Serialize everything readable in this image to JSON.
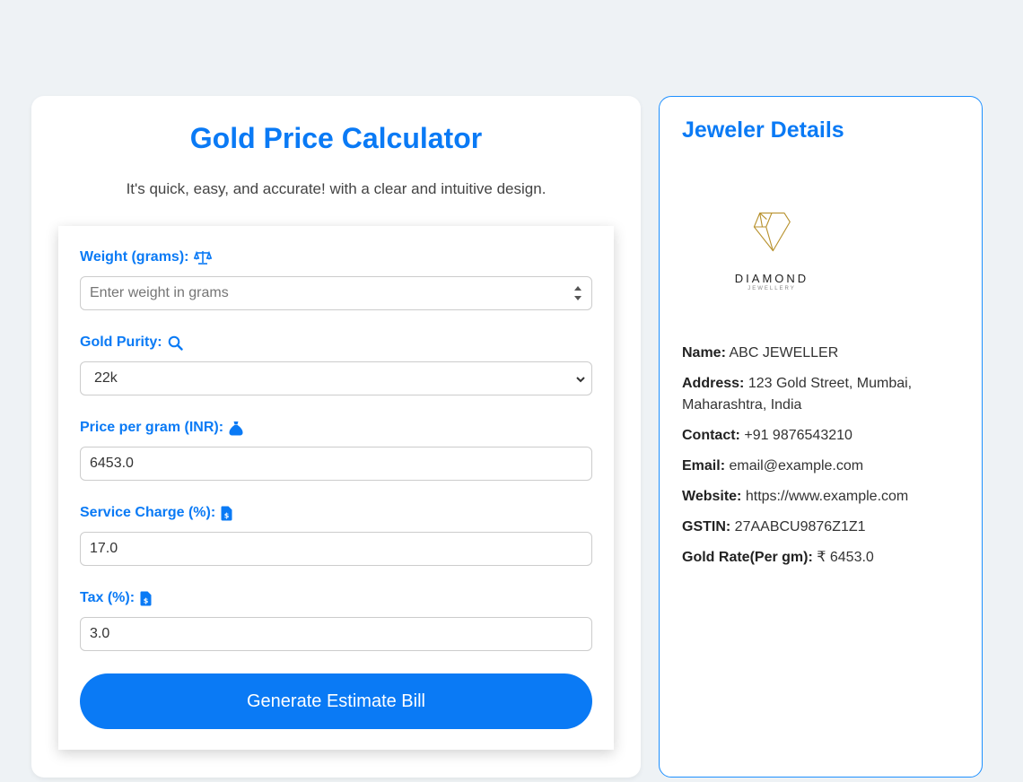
{
  "calculator": {
    "title": "Gold Price Calculator",
    "subtitle": "It's quick, easy, and accurate! with a clear and intuitive design.",
    "fields": {
      "weight": {
        "label": "Weight (grams):",
        "placeholder": "Enter weight in grams",
        "value": "",
        "icon": "scale-icon"
      },
      "purity": {
        "label": "Gold Purity:",
        "value": "22k",
        "icon": "search-icon"
      },
      "price": {
        "label": "Price per gram (INR):",
        "value": "6453.0",
        "icon": "money-bag-icon"
      },
      "service": {
        "label": "Service Charge (%):",
        "value": "17.0",
        "icon": "invoice-icon"
      },
      "tax": {
        "label": "Tax (%):",
        "value": "3.0",
        "icon": "invoice-icon"
      }
    },
    "submit_label": "Generate Estimate Bill"
  },
  "jeweler": {
    "title": "Jeweler Details",
    "logo": {
      "name": "DIAMOND",
      "sub": "JEWELLERY",
      "icon": "diamond-logo"
    },
    "details": [
      {
        "label": "Name:",
        "value": "ABC JEWELLER"
      },
      {
        "label": "Address:",
        "value": "123 Gold Street, Mumbai, Maharashtra, India"
      },
      {
        "label": "Contact:",
        "value": "+91 9876543210"
      },
      {
        "label": "Email:",
        "value": "email@example.com"
      },
      {
        "label": "Website:",
        "value": "https://www.example.com"
      },
      {
        "label": "GSTIN:",
        "value": "27AABCU9876Z1Z1"
      },
      {
        "label": "Gold Rate(Per gm):",
        "value": "₹ 6453.0"
      }
    ]
  },
  "colors": {
    "accent": "#0a7af5",
    "background": "#eef2f5",
    "logo_gold": "#b8922e"
  }
}
